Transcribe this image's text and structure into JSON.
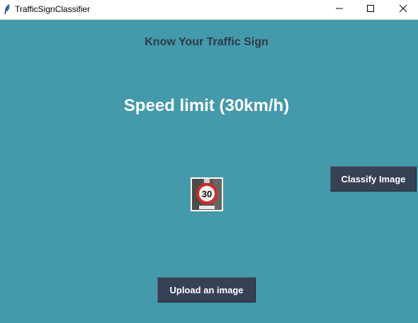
{
  "window": {
    "title": "TrafficSignClassifier",
    "controls": [
      "minimize-icon",
      "maximize-icon",
      "close-icon"
    ]
  },
  "main": {
    "heading": "Know Your Traffic Sign",
    "result_label": "Speed limit (30km/h)",
    "classify_button_label": "Classify Image",
    "upload_button_label": "Upload an image",
    "uploaded_image": {
      "subject": "speed-limit-sign",
      "sign_text": "30"
    }
  },
  "colors": {
    "background": "#4499ab",
    "button": "#364156",
    "heading_text": "#2e3a4a",
    "result_text": "#ffffff",
    "sign_ring": "#d12b2b"
  }
}
